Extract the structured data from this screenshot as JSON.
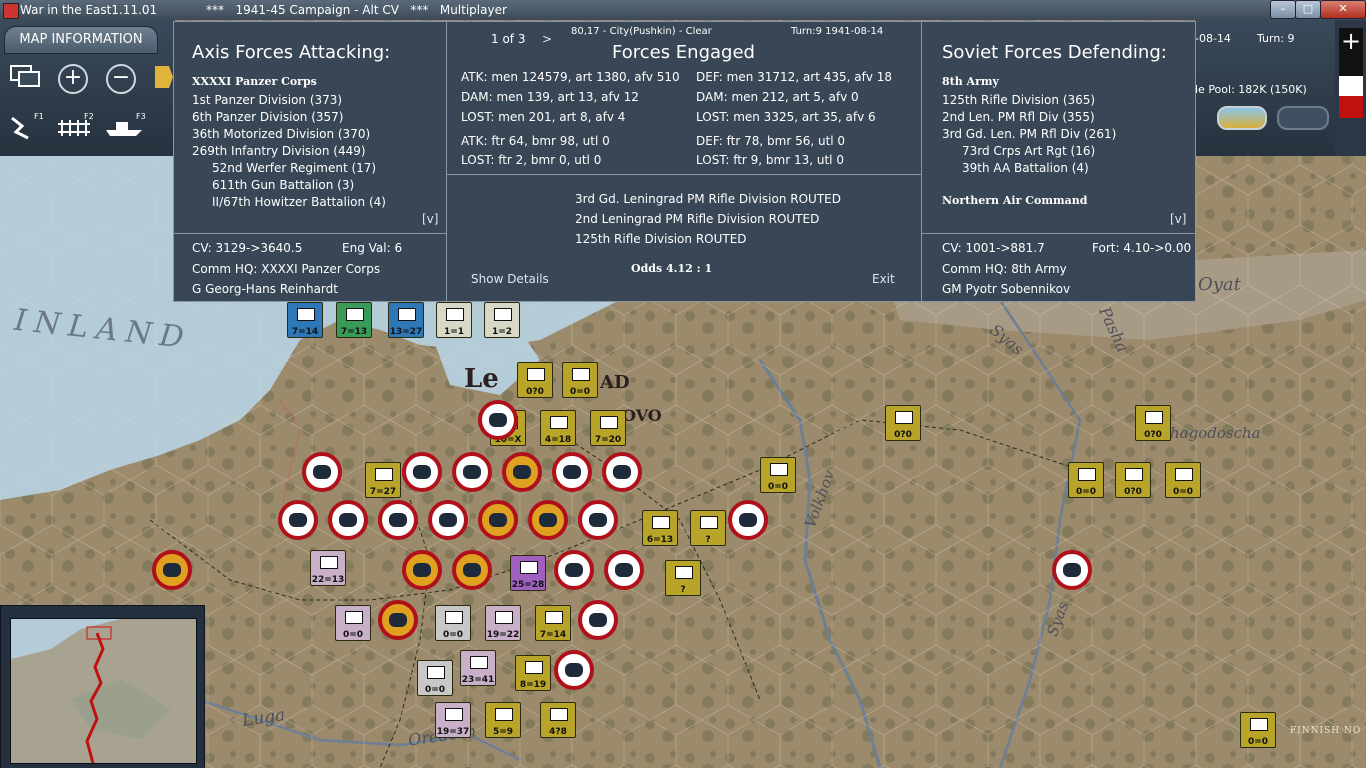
{
  "window": {
    "app_title": "War in the East1.11.01",
    "scenario": "***   1941-45 Campaign - Alt CV   ***   Multiplayer",
    "buttons": [
      "–",
      "□",
      "✕"
    ]
  },
  "toolbar": {
    "map_info_tab": "MAP INFORMATION",
    "fkeys": [
      "F1",
      "F2",
      "F3"
    ],
    "date_fragment": "-08-14",
    "turn": "Turn: 9",
    "pool": "le Pool: 182K (150K)"
  },
  "dialog": {
    "axis": {
      "title": "Axis Forces Attacking:",
      "corps": "XXXXI Panzer Corps",
      "units": [
        "1st Panzer Division (373)",
        "6th Panzer Division (357)",
        "36th Motorized Division (370)",
        "269th Infantry Division (449)",
        "52nd Werfer Regiment (17)",
        "611th Gun Battalion (3)",
        "II/67th Howitzer Battalion (4)"
      ],
      "expand": "[v]",
      "cv": "CV: 3129->3640.5",
      "eng_val": "Eng Val: 6",
      "comm_hq": "Comm HQ: XXXXI Panzer Corps",
      "leader": "G Georg-Hans Reinhardt"
    },
    "center": {
      "pager": "1 of 3",
      "next": ">",
      "location": "80,17 - City(Pushkin) - Clear",
      "turn_date": "Turn:9  1941-08-14",
      "title": "Forces Engaged",
      "atk_men": "ATK: men 124579, art 1380, afv 510",
      "def_men": "DEF: men 31712, art 435, afv 18",
      "atk_dam": "DAM: men 139, art 13, afv 12",
      "def_dam": "DAM: men 212, art 5, afv 0",
      "atk_lost": "LOST: men 201, art 8, afv 4",
      "def_lost": "LOST: men 3325, art 35, afv 6",
      "atk_air": "ATK: ftr 64, bmr 98, utl 0",
      "def_air": "DEF: ftr 78, bmr 56, utl 0",
      "atk_air_lost": "LOST: ftr 2, bmr 0, utl 0",
      "def_air_lost": "LOST: ftr 9, bmr 13, utl 0",
      "results": [
        "3rd Gd. Leningrad PM Rifle Division ROUTED",
        "2nd Leningrad PM Rifle Division ROUTED",
        "125th Rifle Division ROUTED"
      ],
      "odds": "Odds 4.12 : 1",
      "show_details": "Show Details",
      "exit": "Exit"
    },
    "soviet": {
      "title": "Soviet Forces Defending:",
      "army": "8th Army",
      "units": [
        "125th Rifle Division (365)",
        "2nd Len. PM Rfl Div (355)",
        "3rd Gd. Len. PM Rfl Div (261)",
        "73rd Crps Art Rgt (16)",
        "39th AA Battalion (4)"
      ],
      "air_command": "Northern Air Command",
      "expand": "[v]",
      "cv": "CV: 1001->881.7",
      "fort": "Fort: 4.10->0.00",
      "comm_hq": "Comm HQ: 8th Army",
      "leader": "GM Pyotr Sobennikov"
    }
  },
  "map": {
    "labels": {
      "finland": "INLAND",
      "lake": "Oyat",
      "river1": "Syas",
      "river2": "Pasha",
      "river3": "Volkhov",
      "river4": "Syas",
      "town1": "hagodoscha",
      "city": "Le",
      "city2": "AD",
      "city3": "OVO",
      "luga": "Luga",
      "oredezh": "Oredezh",
      "finnish": "FINNISH NO"
    },
    "counters": [
      {
        "label": "7=14",
        "color": "#2f78b8"
      },
      {
        "label": "7=13",
        "color": "#3a9a58"
      },
      {
        "label": "13=27",
        "color": "#2f78b8"
      },
      {
        "label": "1=1",
        "color": "#d8d8c8"
      },
      {
        "label": "1=2",
        "color": "#d8d8c8"
      },
      {
        "label": "0?0",
        "color": "#b8a428"
      },
      {
        "label": "0=0",
        "color": "#b8a428"
      },
      {
        "label": "10=X",
        "color": "#b8a428"
      },
      {
        "label": "4=18",
        "color": "#b8a428"
      },
      {
        "label": "7=20",
        "color": "#b8a428"
      },
      {
        "label": "0?0",
        "color": "#b8a428"
      },
      {
        "label": "0?0",
        "color": "#b8a428"
      },
      {
        "label": "7=27",
        "color": "#b8a428"
      },
      {
        "label": "0=0",
        "color": "#b8a428"
      },
      {
        "label": "0=0",
        "color": "#b8a428"
      },
      {
        "label": "0?0",
        "color": "#b8a428"
      },
      {
        "label": "0=0",
        "color": "#b8a428"
      },
      {
        "label": "6=13",
        "color": "#b8a428"
      },
      {
        "label": "?",
        "color": "#b8a428"
      },
      {
        "label": "?",
        "color": "#b8a428"
      },
      {
        "label": "22=13",
        "color": "#c8b0c8"
      },
      {
        "label": "25=28",
        "color": "#a060c0"
      },
      {
        "label": "0=0",
        "color": "#c8b0c8"
      },
      {
        "label": "0=0",
        "color": "#c8c8c8"
      },
      {
        "label": "19=22",
        "color": "#c8b0c8"
      },
      {
        "label": "7=14",
        "color": "#b8a428"
      },
      {
        "label": "23=41",
        "color": "#c8b0c8"
      },
      {
        "label": "0=0",
        "color": "#c8c8c8"
      },
      {
        "label": "8=19",
        "color": "#b8a428"
      },
      {
        "label": "19=37",
        "color": "#c8b0c8"
      },
      {
        "label": "5=9",
        "color": "#b8a428"
      },
      {
        "label": "4?8",
        "color": "#b8a428"
      },
      {
        "label": "0=0",
        "color": "#b8a428"
      }
    ],
    "minimap_title": ""
  },
  "colors": {
    "dialog_bg": "#384655",
    "axis_red": "#b0101a",
    "soviet_yellow": "#b8a428",
    "sea": "#b4cbd8",
    "land": "#9c8a6c"
  }
}
